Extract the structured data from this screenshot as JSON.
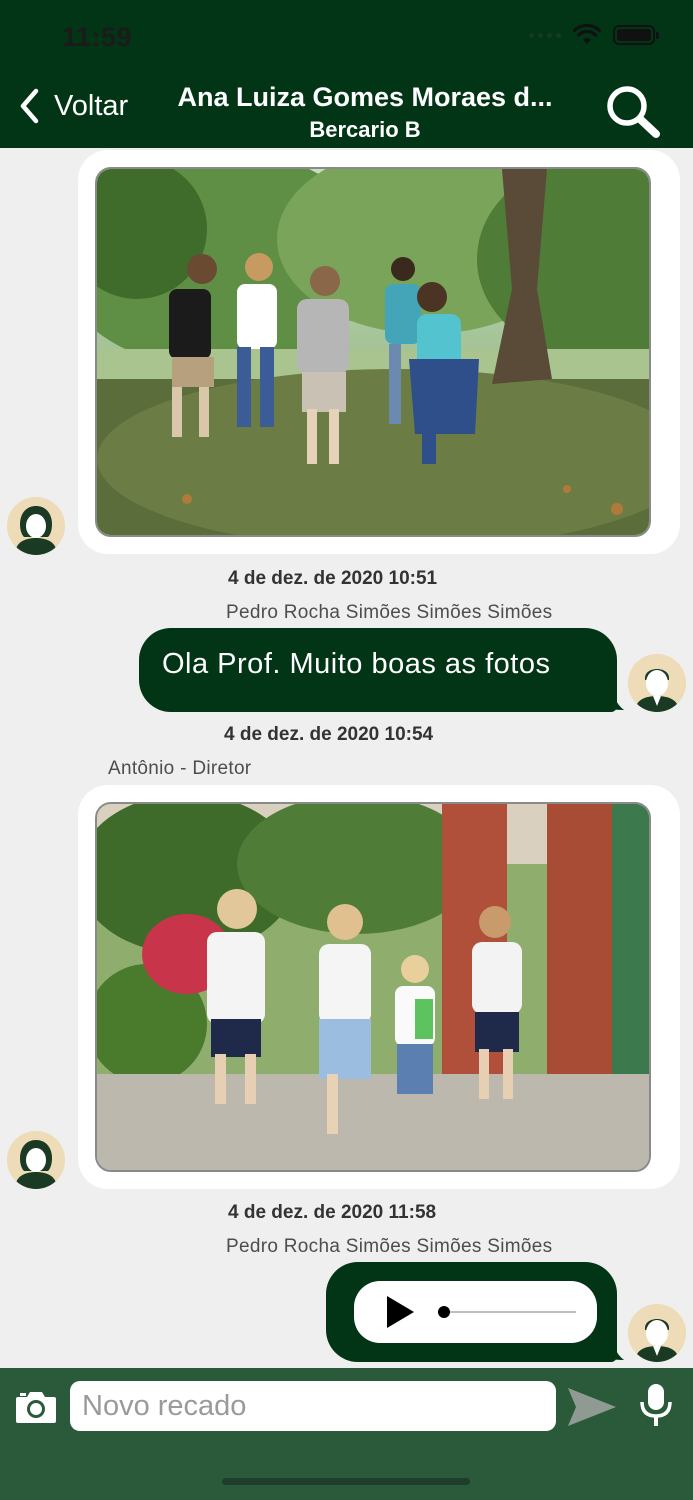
{
  "status_bar": {
    "time": "11:59"
  },
  "header": {
    "back_label": "Voltar",
    "title": "Ana Luiza Gomes Moraes d...",
    "subtitle": "Bercario B"
  },
  "messages": [
    {
      "type": "image",
      "direction": "incoming",
      "image": "children-playing-in-park-photo"
    },
    {
      "type": "text",
      "direction": "outgoing",
      "timestamp": "4 de dez. de 2020 10:51",
      "sender": "Pedro Rocha Simões Simões Simões",
      "text": "Ola Prof. Muito boas as fotos"
    },
    {
      "type": "image",
      "direction": "incoming",
      "timestamp": "4 de dez. de 2020 10:54",
      "sender": "Antônio - Diretor",
      "image": "children-with-backpacks-running-photo"
    },
    {
      "type": "audio",
      "direction": "outgoing",
      "timestamp": "4 de dez. de 2020 11:58",
      "sender": "Pedro Rocha Simões Simões Simões",
      "progress": 0
    }
  ],
  "composer": {
    "placeholder": "Novo recado"
  },
  "colors": {
    "brand_green": "#023516",
    "bar_green": "#2a5a3a",
    "background": "#efefef"
  }
}
